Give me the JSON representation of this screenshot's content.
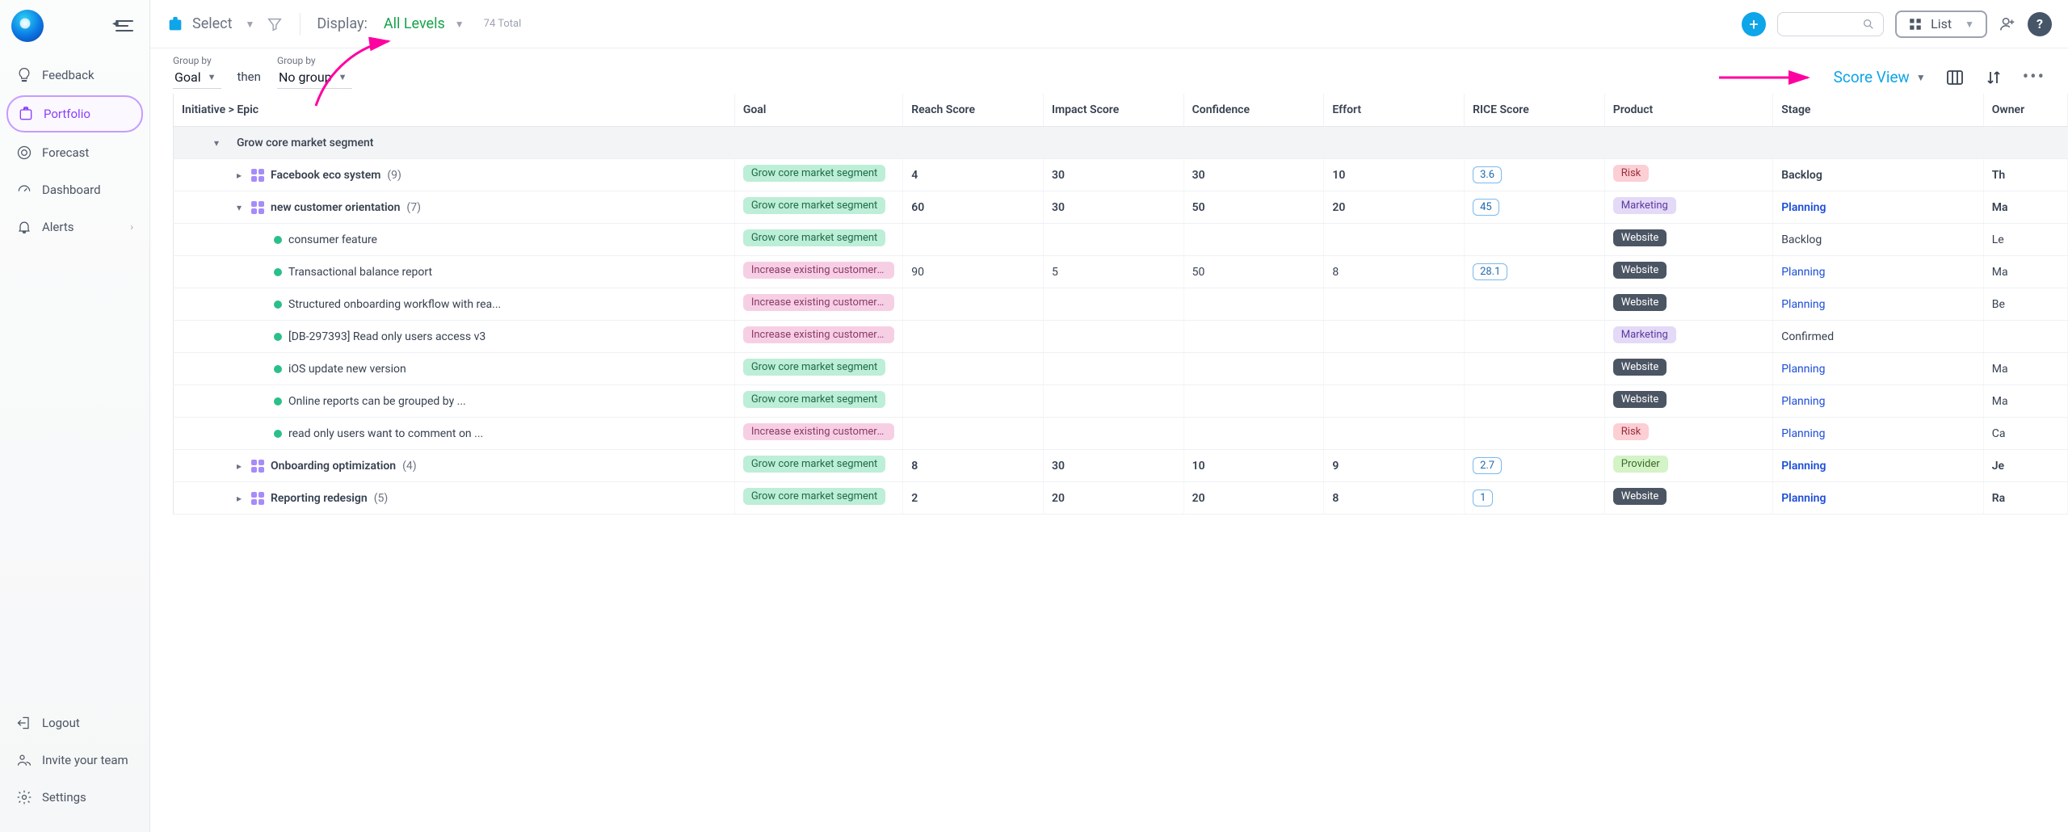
{
  "sidebar": {
    "items": [
      {
        "key": "feedback",
        "label": "Feedback"
      },
      {
        "key": "portfolio",
        "label": "Portfolio"
      },
      {
        "key": "forecast",
        "label": "Forecast"
      },
      {
        "key": "dashboard",
        "label": "Dashboard"
      },
      {
        "key": "alerts",
        "label": "Alerts"
      }
    ],
    "bottom": [
      {
        "key": "logout",
        "label": "Logout"
      },
      {
        "key": "invite",
        "label": "Invite your team"
      },
      {
        "key": "settings",
        "label": "Settings"
      }
    ]
  },
  "topbar": {
    "select_label": "Select",
    "display_label": "Display:",
    "display_value": "All Levels",
    "total_count": "74",
    "total_label": "Total",
    "view_mode": "List"
  },
  "groupbar": {
    "group_label": "Group by",
    "group1_value": "Goal",
    "then_label": "then",
    "group2_value": "No group",
    "score_view_label": "Score View"
  },
  "columns": {
    "initiative": "Initiative > Epic",
    "goal": "Goal",
    "reach": "Reach Score",
    "impact": "Impact Score",
    "confidence": "Confidence",
    "effort": "Effort",
    "rice": "RICE Score",
    "product": "Product",
    "stage": "Stage",
    "owner": "Owner"
  },
  "goals": {
    "grow": "Grow core market segment",
    "increase": "Increase existing customer value"
  },
  "products": {
    "risk": "Risk",
    "marketing": "Marketing",
    "website": "Website",
    "provider": "Provider"
  },
  "stages": {
    "backlog": "Backlog",
    "planning": "Planning",
    "confirmed": "Confirmed"
  },
  "rows": {
    "group1": {
      "name": "Grow core market segment"
    },
    "r1": {
      "name": "Facebook eco system",
      "count": "(9)",
      "reach": "4",
      "impact": "30",
      "conf": "30",
      "effort": "10",
      "rice": "3.6",
      "owner": "Th"
    },
    "r2": {
      "name": "new customer orientation",
      "count": "(7)",
      "reach": "60",
      "impact": "30",
      "conf": "50",
      "effort": "20",
      "rice": "45",
      "owner": "Ma"
    },
    "r3": {
      "name": "consumer feature",
      "owner": "Le"
    },
    "r4": {
      "name": "Transactional balance report",
      "reach": "90",
      "impact": "5",
      "conf": "50",
      "effort": "8",
      "rice": "28.1",
      "owner": "Ma"
    },
    "r5": {
      "name": "Structured onboarding workflow with rea...",
      "owner": "Be"
    },
    "r6": {
      "name": "[DB-297393] Read only users access v3"
    },
    "r7": {
      "name": "iOS update new version",
      "owner": "Ma"
    },
    "r8": {
      "name": "Online reports can be grouped by ...",
      "owner": "Ma"
    },
    "r9": {
      "name": "read only users want to comment on ...",
      "owner": "Ca"
    },
    "r10": {
      "name": "Onboarding optimization",
      "count": "(4)",
      "reach": "8",
      "impact": "30",
      "conf": "10",
      "effort": "9",
      "rice": "2.7",
      "owner": "Je"
    },
    "r11": {
      "name": "Reporting redesign",
      "count": "(5)",
      "reach": "2",
      "impact": "20",
      "conf": "20",
      "effort": "8",
      "rice": "1",
      "owner": "Ra"
    }
  }
}
